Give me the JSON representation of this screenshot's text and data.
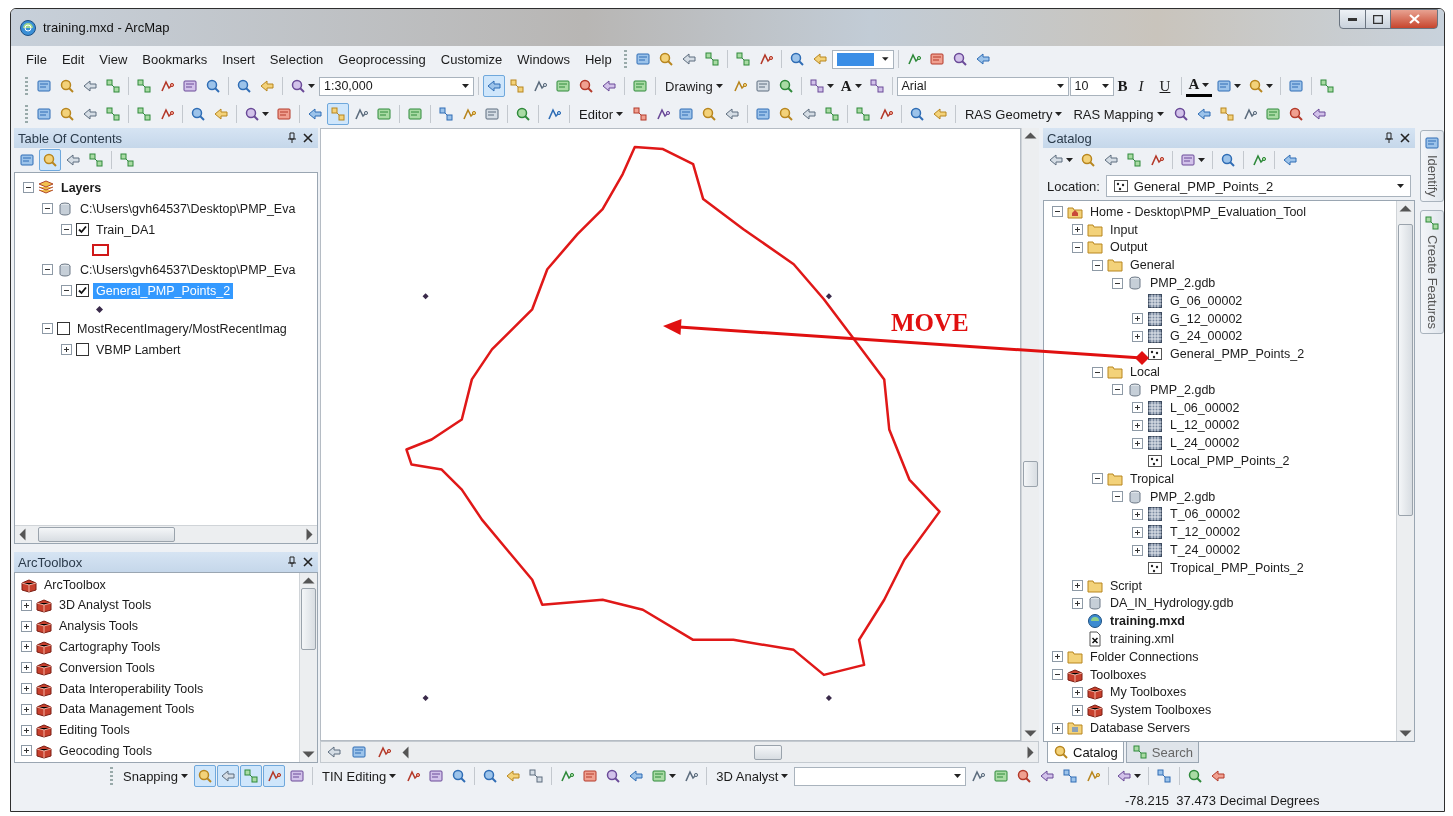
{
  "window": {
    "title": "training.mxd - ArcMap"
  },
  "menu": [
    "File",
    "Edit",
    "View",
    "Bookmarks",
    "Insert",
    "Selection",
    "Geoprocessing",
    "Customize",
    "Windows",
    "Help"
  ],
  "menu_row_tools": [
    [
      {
        "kind": "button",
        "pressed": false
      },
      {
        "kind": "button",
        "pressed": false
      },
      {
        "kind": "button",
        "pressed": false
      },
      {
        "kind": "button",
        "pressed": false
      }
    ],
    [
      {
        "kind": "button",
        "pressed": false
      },
      {
        "kind": "button",
        "pressed": false
      }
    ],
    [
      {
        "kind": "button",
        "pressed": false
      },
      {
        "kind": "button",
        "pressed": false
      },
      {
        "kind": "combo",
        "highlighted": true
      }
    ],
    [
      {
        "kind": "button",
        "pressed": false
      },
      {
        "kind": "button",
        "pressed": false
      },
      {
        "kind": "button",
        "pressed": false
      },
      {
        "kind": "button",
        "pressed": false
      }
    ]
  ],
  "standard_toolbar": [
    [
      {
        "kind": "button",
        "pressed": false
      },
      {
        "kind": "button",
        "pressed": false
      },
      {
        "kind": "button",
        "pressed": false
      },
      {
        "kind": "button",
        "pressed": false
      }
    ],
    [
      {
        "kind": "button",
        "pressed": false
      },
      {
        "kind": "button",
        "pressed": false
      },
      {
        "kind": "button",
        "pressed": false
      },
      {
        "kind": "button",
        "pressed": false
      }
    ],
    [
      {
        "kind": "button",
        "pressed": false
      },
      {
        "kind": "button",
        "pressed": false
      }
    ],
    [
      {
        "kind": "split",
        "pressed": false
      },
      {
        "kind": "scale",
        "value": "1:30,000"
      }
    ],
    [
      {
        "kind": "button",
        "pressed": true
      },
      {
        "kind": "button",
        "pressed": false
      },
      {
        "kind": "button",
        "pressed": false
      },
      {
        "kind": "button",
        "pressed": false
      },
      {
        "kind": "button",
        "pressed": false
      },
      {
        "kind": "button",
        "pressed": false
      }
    ],
    [
      {
        "kind": "button",
        "pressed": false
      }
    ],
    [
      {
        "kind": "dropdown",
        "label": "Drawing"
      },
      {
        "kind": "button",
        "pressed": false
      },
      {
        "kind": "button",
        "pressed": false
      },
      {
        "kind": "button",
        "pressed": false
      }
    ],
    [
      {
        "kind": "split",
        "pressed": false
      },
      {
        "kind": "text-symbol",
        "label": "A"
      },
      {
        "kind": "button",
        "pressed": false
      }
    ],
    [
      {
        "kind": "font",
        "value": "Arial"
      },
      {
        "kind": "size",
        "value": "10"
      },
      {
        "kind": "bold",
        "label": "B"
      },
      {
        "kind": "italic",
        "label": "I"
      },
      {
        "kind": "underline",
        "label": "U"
      }
    ],
    [
      {
        "kind": "font-color",
        "label": "A"
      },
      {
        "kind": "split",
        "pressed": false
      },
      {
        "kind": "split",
        "pressed": false
      }
    ],
    [
      {
        "kind": "button",
        "pressed": false
      }
    ],
    [
      {
        "kind": "button",
        "pressed": false
      }
    ]
  ],
  "tools_toolbar": [
    [
      {
        "kind": "button",
        "pressed": false
      },
      {
        "kind": "button",
        "pressed": false
      },
      {
        "kind": "button",
        "pressed": false
      },
      {
        "kind": "button",
        "pressed": false
      }
    ],
    [
      {
        "kind": "button",
        "pressed": false
      },
      {
        "kind": "button",
        "pressed": false
      }
    ],
    [
      {
        "kind": "button",
        "pressed": false
      },
      {
        "kind": "button",
        "pressed": false
      }
    ],
    [
      {
        "kind": "split",
        "pressed": false
      },
      {
        "kind": "button",
        "pressed": false
      }
    ],
    [
      {
        "kind": "button",
        "pressed": false
      },
      {
        "kind": "button",
        "pressed": true
      },
      {
        "kind": "button",
        "pressed": false
      },
      {
        "kind": "button",
        "pressed": false
      }
    ],
    [
      {
        "kind": "button",
        "pressed": false
      }
    ],
    [
      {
        "kind": "button",
        "pressed": false
      },
      {
        "kind": "button",
        "pressed": false
      },
      {
        "kind": "button",
        "pressed": false
      }
    ],
    [
      {
        "kind": "button",
        "pressed": false
      }
    ],
    [
      {
        "kind": "button",
        "pressed": false
      }
    ],
    [
      {
        "kind": "dropdown",
        "label": "Editor"
      },
      {
        "kind": "button",
        "pressed": false
      },
      {
        "kind": "button",
        "pressed": false
      },
      {
        "kind": "button",
        "pressed": false
      },
      {
        "kind": "button",
        "pressed": false
      },
      {
        "kind": "button",
        "pressed": false
      }
    ],
    [
      {
        "kind": "button",
        "pressed": false
      },
      {
        "kind": "button",
        "pressed": false
      },
      {
        "kind": "button",
        "pressed": false
      },
      {
        "kind": "button",
        "pressed": false
      }
    ],
    [
      {
        "kind": "button",
        "pressed": false
      },
      {
        "kind": "button",
        "pressed": false
      }
    ],
    [
      {
        "kind": "button",
        "pressed": false
      },
      {
        "kind": "button",
        "pressed": false
      }
    ],
    [
      {
        "kind": "dropdown",
        "label": "RAS Geometry"
      },
      {
        "kind": "dropdown",
        "label": "RAS Mapping"
      },
      {
        "kind": "button",
        "pressed": false
      },
      {
        "kind": "button",
        "pressed": false
      },
      {
        "kind": "button",
        "pressed": false
      },
      {
        "kind": "button",
        "pressed": false
      },
      {
        "kind": "button",
        "pressed": false
      },
      {
        "kind": "button",
        "pressed": false
      },
      {
        "kind": "button",
        "pressed": false
      }
    ]
  ],
  "table_of_contents": {
    "title": "Table Of Contents",
    "toolbar": [
      [
        {
          "kind": "button",
          "pressed": false
        },
        {
          "kind": "button",
          "pressed": true
        },
        {
          "kind": "button",
          "pressed": false
        },
        {
          "kind": "button",
          "pressed": false
        }
      ],
      [
        {
          "kind": "button",
          "pressed": false
        }
      ]
    ],
    "tree": [
      {
        "kind": "frame",
        "label": "Layers",
        "expanded": true,
        "children": [
          {
            "kind": "source",
            "label": "C:\\Users\\gvh64537\\Desktop\\PMP_Eva",
            "expanded": true,
            "children": [
              {
                "kind": "layer",
                "label": "Train_DA1",
                "expanded": true,
                "checked": true,
                "selected": false,
                "children": [
                  {
                    "kind": "polygon-symbol"
                  }
                ]
              }
            ]
          },
          {
            "kind": "source",
            "label": "C:\\Users\\gvh64537\\Desktop\\PMP_Eva",
            "expanded": true,
            "children": [
              {
                "kind": "layer",
                "label": "General_PMP_Points_2",
                "expanded": true,
                "checked": true,
                "selected": true,
                "children": [
                  {
                    "kind": "point-symbol"
                  }
                ]
              }
            ]
          },
          {
            "kind": "layer",
            "label": "MostRecentImagery/MostRecentImag",
            "expanded": true,
            "checked": false,
            "selected": false,
            "children": [
              {
                "kind": "layer",
                "label": "VBMP Lambert",
                "expanded": false,
                "checked": false,
                "selected": false
              }
            ]
          }
        ]
      }
    ]
  },
  "arctoolbox": {
    "title": "ArcToolbox",
    "root": "ArcToolbox",
    "items": [
      {
        "label": "3D Analyst Tools",
        "expanded": false
      },
      {
        "label": "Analysis Tools",
        "expanded": false
      },
      {
        "label": "Cartography Tools",
        "expanded": false
      },
      {
        "label": "Conversion Tools",
        "expanded": false
      },
      {
        "label": "Data Interoperability Tools",
        "expanded": false
      },
      {
        "label": "Data Management Tools",
        "expanded": false
      },
      {
        "label": "Editing Tools",
        "expanded": false
      },
      {
        "label": "Geocoding Tools",
        "expanded": false
      }
    ]
  },
  "map": {
    "annotation": "MOVE"
  },
  "catalog": {
    "title": "Catalog",
    "toolbar": [
      [
        {
          "kind": "split",
          "pressed": false
        },
        {
          "kind": "button",
          "pressed": false
        },
        {
          "kind": "button",
          "pressed": false
        },
        {
          "kind": "button",
          "pressed": false
        },
        {
          "kind": "button",
          "pressed": false
        }
      ],
      [
        {
          "kind": "split",
          "pressed": false
        }
      ],
      [
        {
          "kind": "button",
          "pressed": false
        }
      ],
      [
        {
          "kind": "button",
          "pressed": false
        }
      ],
      [
        {
          "kind": "button",
          "pressed": false
        }
      ]
    ],
    "location_label": "Location:",
    "location": "General_PMP_Points_2",
    "tree": [
      {
        "kind": "home",
        "label": "Home - Desktop\\PMP_Evaluation_Tool",
        "expanded": true,
        "children": [
          {
            "kind": "folder",
            "label": "Input",
            "expanded": false
          },
          {
            "kind": "folder",
            "label": "Output",
            "expanded": true,
            "children": [
              {
                "kind": "folder",
                "label": "General",
                "expanded": true,
                "children": [
                  {
                    "kind": "gdb",
                    "label": "PMP_2.gdb",
                    "expanded": true,
                    "children": [
                      {
                        "kind": "raster",
                        "label": "G_06_00002"
                      },
                      {
                        "kind": "raster",
                        "label": "G_12_00002",
                        "expanded": false
                      },
                      {
                        "kind": "raster",
                        "label": "G_24_00002",
                        "expanded": false
                      },
                      {
                        "kind": "points",
                        "label": "General_PMP_Points_2"
                      }
                    ]
                  }
                ]
              },
              {
                "kind": "folder",
                "label": "Local",
                "expanded": true,
                "children": [
                  {
                    "kind": "gdb",
                    "label": "PMP_2.gdb",
                    "expanded": true,
                    "children": [
                      {
                        "kind": "raster",
                        "label": "L_06_00002",
                        "expanded": false
                      },
                      {
                        "kind": "raster",
                        "label": "L_12_00002",
                        "expanded": false
                      },
                      {
                        "kind": "raster",
                        "label": "L_24_00002",
                        "expanded": false
                      },
                      {
                        "kind": "points",
                        "label": "Local_PMP_Points_2"
                      }
                    ]
                  }
                ]
              },
              {
                "kind": "folder",
                "label": "Tropical",
                "expanded": true,
                "children": [
                  {
                    "kind": "gdb",
                    "label": "PMP_2.gdb",
                    "expanded": true,
                    "children": [
                      {
                        "kind": "raster",
                        "label": "T_06_00002",
                        "expanded": false
                      },
                      {
                        "kind": "raster",
                        "label": "T_12_00002",
                        "expanded": false
                      },
                      {
                        "kind": "raster",
                        "label": "T_24_00002",
                        "expanded": false
                      },
                      {
                        "kind": "points",
                        "label": "Tropical_PMP_Points_2"
                      }
                    ]
                  }
                ]
              }
            ]
          },
          {
            "kind": "folder",
            "label": "Script",
            "expanded": false
          },
          {
            "kind": "gdb",
            "label": "DA_IN_Hydrology.gdb",
            "expanded": false
          },
          {
            "kind": "mxd",
            "label": "training.mxd"
          },
          {
            "kind": "xml",
            "label": "training.xml"
          }
        ]
      },
      {
        "kind": "connections",
        "label": "Folder Connections",
        "expanded": false
      },
      {
        "kind": "toolboxes",
        "label": "Toolboxes",
        "expanded": true,
        "children": [
          {
            "kind": "toolbox",
            "label": "My Toolboxes",
            "expanded": false
          },
          {
            "kind": "toolbox",
            "label": "System Toolboxes",
            "expanded": false
          }
        ]
      },
      {
        "kind": "servers",
        "label": "Database Servers",
        "expanded": false
      }
    ],
    "tabs": [
      {
        "label": "Catalog",
        "selected": true
      },
      {
        "label": "Search",
        "selected": false
      }
    ]
  },
  "side_tabs": [
    {
      "label": "Identify"
    },
    {
      "label": "Create Features"
    }
  ],
  "bottom_toolbar": [
    [
      {
        "kind": "dropdown",
        "label": "Snapping"
      },
      {
        "kind": "button",
        "pressed": true
      },
      {
        "kind": "button",
        "pressed": true
      },
      {
        "kind": "button",
        "pressed": true
      },
      {
        "kind": "button",
        "pressed": true
      },
      {
        "kind": "button",
        "pressed": false
      }
    ],
    [
      {
        "kind": "dropdown",
        "label": "TIN Editing"
      },
      {
        "kind": "button",
        "pressed": false
      },
      {
        "kind": "button",
        "pressed": false
      },
      {
        "kind": "button",
        "pressed": false
      }
    ],
    [
      {
        "kind": "button",
        "pressed": false
      },
      {
        "kind": "button",
        "pressed": false
      },
      {
        "kind": "button",
        "pressed": false
      }
    ],
    [
      {
        "kind": "button",
        "pressed": false
      },
      {
        "kind": "button",
        "pressed": false
      },
      {
        "kind": "button",
        "pressed": false
      },
      {
        "kind": "button",
        "pressed": false
      },
      {
        "kind": "split",
        "pressed": false
      },
      {
        "kind": "button",
        "pressed": false
      }
    ],
    [
      {
        "kind": "dropdown",
        "label": "3D Analyst"
      },
      {
        "kind": "combo",
        "highlighted": false
      },
      {
        "kind": "button",
        "pressed": false
      },
      {
        "kind": "button",
        "pressed": false
      },
      {
        "kind": "button",
        "pressed": false
      },
      {
        "kind": "button",
        "pressed": false
      },
      {
        "kind": "button",
        "pressed": false
      },
      {
        "kind": "button",
        "pressed": false
      }
    ],
    [
      {
        "kind": "split",
        "pressed": false
      }
    ],
    [
      {
        "kind": "button",
        "pressed": false
      }
    ],
    [
      {
        "kind": "button",
        "pressed": false
      },
      {
        "kind": "button",
        "pressed": false
      }
    ]
  ],
  "status_bar": {
    "coordinates": "-78.215  37.473 Decimal Degrees"
  }
}
